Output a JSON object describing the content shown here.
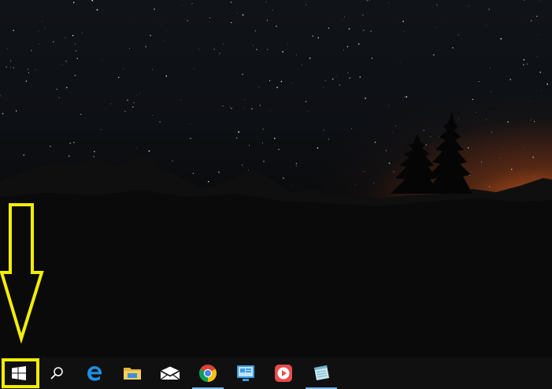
{
  "desktop": {
    "wallpaper": "night-sky-mountains-with-pine-trees",
    "accent_glow_color": "#ff6e1e"
  },
  "annotation": {
    "arrow_color": "#f2ee00",
    "highlight_target": "start-button"
  },
  "taskbar": {
    "background": "#101010",
    "running_indicator_color": "#76b9ed",
    "items": [
      {
        "name": "start",
        "icon": "windows-logo-icon",
        "running": false
      },
      {
        "name": "search",
        "icon": "search-icon",
        "running": false
      },
      {
        "name": "edge",
        "icon": "edge-icon",
        "running": false
      },
      {
        "name": "file-explorer",
        "icon": "folder-icon",
        "running": false
      },
      {
        "name": "mail",
        "icon": "mail-icon",
        "running": false
      },
      {
        "name": "chrome",
        "icon": "chrome-icon",
        "running": true
      },
      {
        "name": "remote-app",
        "icon": "remote-desktop-icon",
        "running": false
      },
      {
        "name": "media-player",
        "icon": "play-icon",
        "running": false
      },
      {
        "name": "notes-app",
        "icon": "notepad-icon",
        "running": true
      }
    ]
  }
}
